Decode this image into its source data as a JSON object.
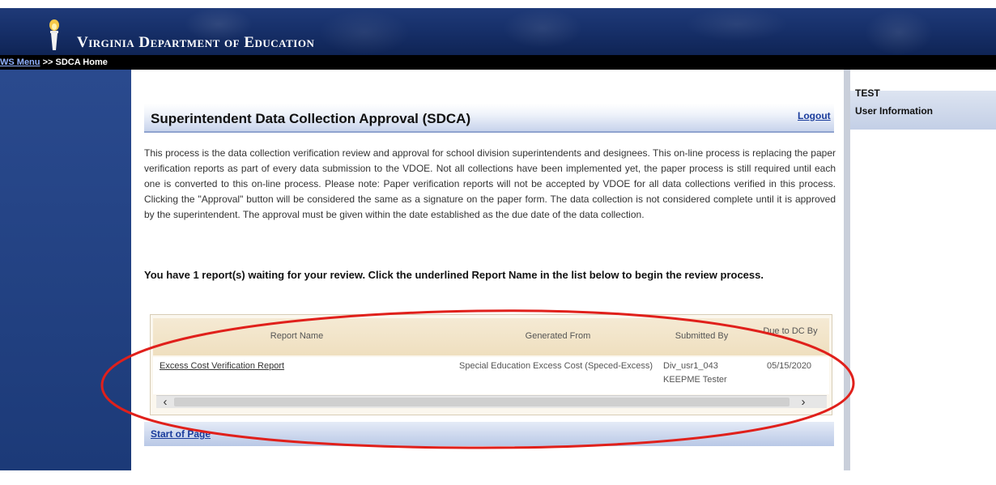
{
  "header": {
    "brand": "Virginia Department of Education",
    "logo_icon": "torch-icon",
    "breadcrumb": {
      "menu_link": "WS Menu",
      "separator": ">>",
      "current": "SDCA Home"
    }
  },
  "right_panel": {
    "label": "TEST",
    "section": "User Information"
  },
  "main": {
    "logout": "Logout",
    "title": "Superintendent Data Collection Approval (SDCA)",
    "description": "This process is the data collection verification review and approval for school division superintendents and designees. This on-line process is replacing the paper verification reports as part of every data submission to the VDOE. Not all collections have been implemented yet, the paper process is still required until each one is converted to this on-line process. Please note: Paper verification reports will not be accepted by VDOE for all data collections verified in this process. Clicking the \"Approval\" button will be considered the same as a signature on the paper form. The data collection is not considered complete until it is approved by the superintendent. The approval must be given within the date established as the due date of the data collection.",
    "prompt": "You have 1 report(s) waiting for your review. Click the underlined Report Name in the list below to begin the review process.",
    "table": {
      "headers": [
        "Report Name",
        "Generated From",
        "Submitted By",
        "Due to DC By"
      ],
      "rows": [
        {
          "report_name": "Excess Cost Verification Report",
          "generated_from": "Special Education Excess Cost (Speced-Excess)",
          "submitted_by": "Div_usr1_043 KEEPME Tester",
          "due_date": "05/15/2020"
        }
      ]
    },
    "start_of_page": "Start of Page"
  },
  "colors": {
    "banner": "#17306a",
    "annotation": "#e0201b",
    "link": "#1a3c9c"
  }
}
